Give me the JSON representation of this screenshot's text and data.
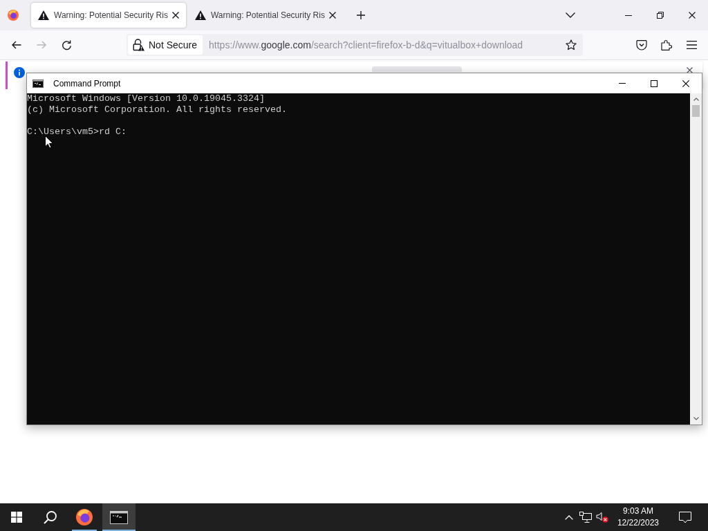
{
  "browser": {
    "tabs": [
      {
        "title": "Warning: Potential Security Ris",
        "selected": true
      },
      {
        "title": "Warning: Potential Security Ris",
        "selected": false
      }
    ],
    "navigation": {
      "back_disabled": false,
      "forward_disabled": true
    },
    "address_bar": {
      "security_label": "Not Secure",
      "url_start": "https://www.",
      "url_domain": "google.com",
      "url_rest": "/search?client=firefox-b-d&q=vitualbox+download"
    }
  },
  "command_prompt": {
    "title": "Command Prompt",
    "output_lines": [
      "Microsoft Windows [Version 10.0.19045.3324]",
      "(c) Microsoft Corporation. All rights reserved."
    ],
    "prompt_line": "C:\\Users\\vm5>rd C:"
  },
  "taskbar": {
    "apps": [
      {
        "kind": "browser",
        "running": true,
        "selected": false
      },
      {
        "kind": "terminal",
        "running": true,
        "selected": true
      }
    ],
    "tray": {
      "volume_muted": true
    },
    "clock": {
      "time": "9:03 AM",
      "date": "12/22/2023"
    }
  }
}
